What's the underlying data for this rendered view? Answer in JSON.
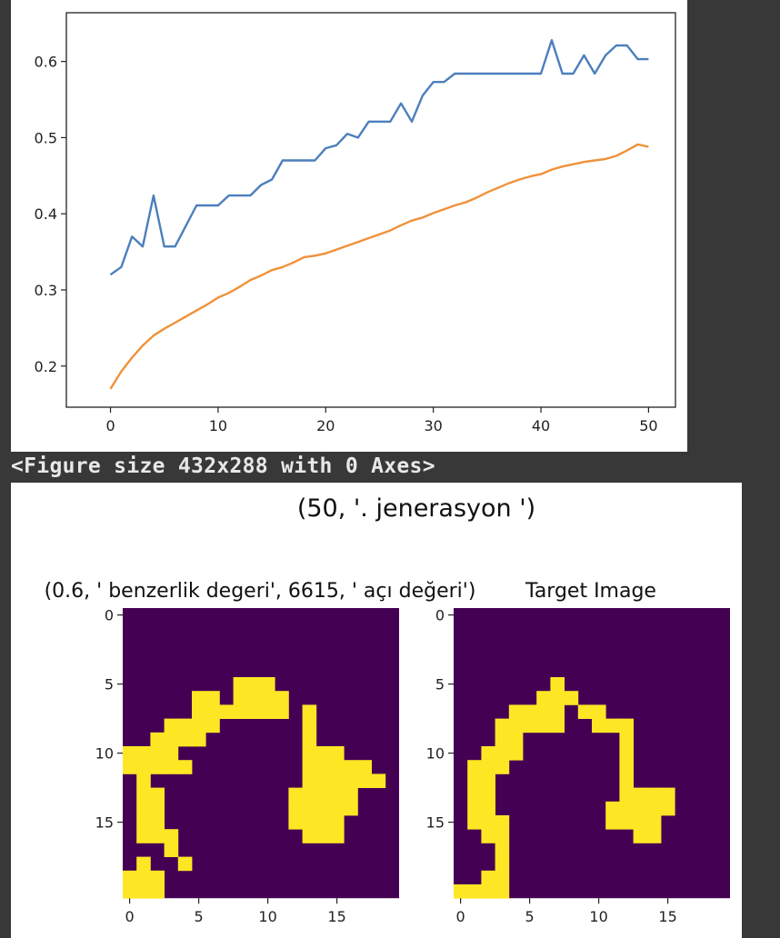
{
  "line_chart": {
    "chart_data": {
      "type": "line",
      "xlim": [
        -4.1,
        52.5
      ],
      "ylim": [
        0.146,
        0.664
      ],
      "x_ticks": [
        0,
        10,
        20,
        30,
        40,
        50
      ],
      "y_ticks": [
        0.2,
        0.3,
        0.4,
        0.5,
        0.6
      ],
      "series": [
        {
          "color": "#4c7fbd",
          "x": [
            0,
            1,
            2,
            3,
            4,
            5,
            6,
            7,
            8,
            9,
            10,
            11,
            12,
            13,
            14,
            15,
            16,
            17,
            18,
            19,
            20,
            21,
            22,
            23,
            24,
            25,
            26,
            27,
            28,
            29,
            30,
            31,
            32,
            33,
            34,
            35,
            36,
            37,
            38,
            39,
            40,
            41,
            42,
            43,
            44,
            45,
            46,
            47,
            48,
            49,
            50
          ],
          "y": [
            0.32,
            0.33,
            0.37,
            0.357,
            0.424,
            0.357,
            0.357,
            0.384,
            0.411,
            0.411,
            0.411,
            0.424,
            0.424,
            0.424,
            0.438,
            0.445,
            0.47,
            0.47,
            0.47,
            0.47,
            0.486,
            0.49,
            0.505,
            0.5,
            0.521,
            0.521,
            0.521,
            0.545,
            0.521,
            0.555,
            0.573,
            0.573,
            0.584,
            0.584,
            0.584,
            0.584,
            0.584,
            0.584,
            0.584,
            0.584,
            0.584,
            0.628,
            0.584,
            0.584,
            0.608,
            0.584,
            0.608,
            0.621,
            0.621,
            0.603,
            0.603
          ]
        },
        {
          "color": "#f0913a",
          "x": [
            0,
            1,
            2,
            3,
            4,
            5,
            6,
            7,
            8,
            9,
            10,
            11,
            12,
            13,
            14,
            15,
            16,
            17,
            18,
            19,
            20,
            21,
            22,
            23,
            24,
            25,
            26,
            27,
            28,
            29,
            30,
            31,
            32,
            33,
            34,
            35,
            36,
            37,
            38,
            39,
            40,
            41,
            42,
            43,
            44,
            45,
            46,
            47,
            48,
            49,
            50
          ],
          "y": [
            0.17,
            0.193,
            0.211,
            0.227,
            0.24,
            0.249,
            0.257,
            0.265,
            0.273,
            0.281,
            0.29,
            0.296,
            0.304,
            0.313,
            0.319,
            0.326,
            0.33,
            0.336,
            0.343,
            0.345,
            0.348,
            0.353,
            0.358,
            0.363,
            0.368,
            0.373,
            0.378,
            0.385,
            0.391,
            0.395,
            0.401,
            0.406,
            0.411,
            0.415,
            0.421,
            0.428,
            0.434,
            0.44,
            0.445,
            0.449,
            0.452,
            0.458,
            0.462,
            0.465,
            0.468,
            0.47,
            0.472,
            0.476,
            0.483,
            0.491,
            0.488
          ]
        }
      ]
    }
  },
  "figure_size_text": "<Figure size 432x288 with 0 Axes>",
  "image_figure": {
    "suptitle": "(50, '. jenerasyon ')",
    "left_title": "(0.6, ' benzerlik degeri', 6615, ' açı değeri')",
    "right_title": "Target Image",
    "x_ticks": [
      0,
      5,
      10,
      15
    ],
    "y_ticks": [
      0,
      5,
      10,
      15
    ],
    "colors": {
      "background": "#440154",
      "foreground": "#fde725"
    },
    "chart_data": [
      {
        "type": "heatmap",
        "name": "generated",
        "rows": [
          "....................",
          "....................",
          "....................",
          "....................",
          "....................",
          "........###.........",
          ".....##.####........",
          ".....#######.#......",
          "...####......#......",
          "..####.......#......",
          "####.........###....",
          "#####........#####..",
          ".#...........######.",
          ".##.........#####...",
          ".##.........#####...",
          ".##.........####....",
          ".###.........###....",
          "...#................",
          ".#..#...............",
          "###.................",
          "###................."
        ]
      },
      {
        "type": "heatmap",
        "name": "target",
        "rows": [
          "....................",
          "....................",
          "....................",
          "....................",
          "....................",
          ".......#............",
          "......###...........",
          "....####.##.........",
          "...#####..###.......",
          "...##.......#.......",
          "..###.......#.......",
          ".###........#.......",
          ".##.........#.......",
          ".##.........####....",
          ".##........#####....",
          ".###.......####.....",
          "..##.........##.....",
          "...#................",
          "...#................",
          "..##................",
          "####................"
        ]
      }
    ]
  }
}
